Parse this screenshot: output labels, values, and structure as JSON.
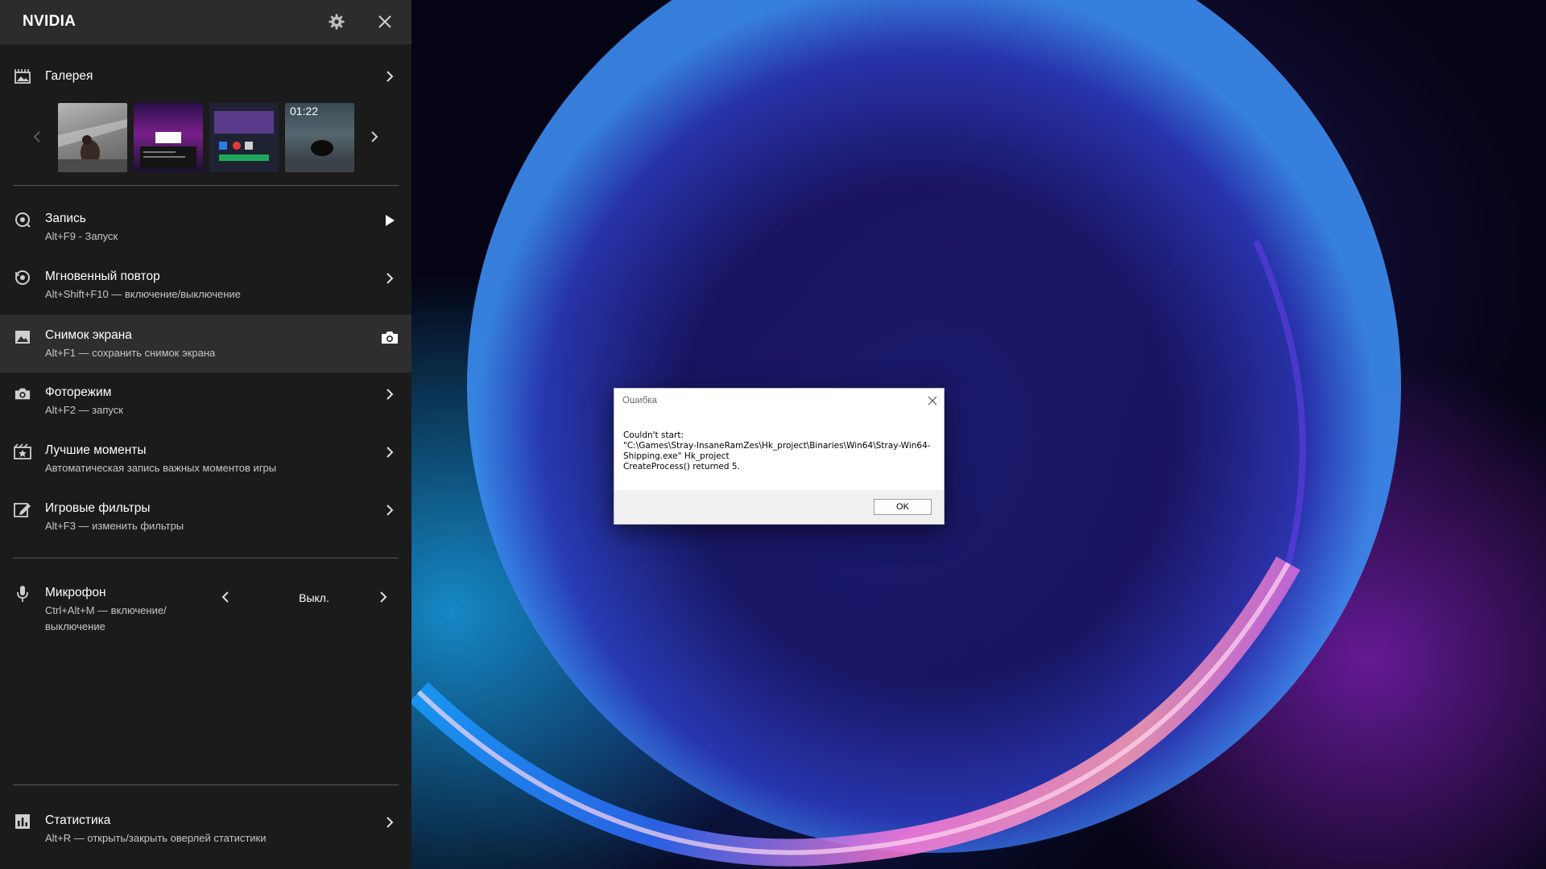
{
  "overlay": {
    "brand": "NVIDIA",
    "gallery": {
      "label": "Галерея",
      "thumbnails": [
        {
          "name": "gallery-thumbnail-1"
        },
        {
          "name": "gallery-thumbnail-2"
        },
        {
          "name": "gallery-thumbnail-3"
        },
        {
          "name": "gallery-thumbnail-4",
          "duration": "01:22"
        }
      ]
    },
    "record": {
      "title": "Запись",
      "subtitle": "Alt+F9 - Запуск"
    },
    "instant_replay": {
      "title": "Мгновенный повтор",
      "subtitle": "Alt+Shift+F10 — включение/выключение"
    },
    "screenshot": {
      "title": "Снимок экрана",
      "subtitle": "Alt+F1 — сохранить снимок экрана"
    },
    "photo_mode": {
      "title": "Фоторежим",
      "subtitle": "Alt+F2 — запуск"
    },
    "highlights": {
      "title": "Лучшие моменты",
      "subtitle": "Автоматическая запись важных моментов игры"
    },
    "game_filters": {
      "title": "Игровые фильтры",
      "subtitle": "Alt+F3 — изменить фильтры"
    },
    "microphone": {
      "title": "Микрофон",
      "subtitle_line1": "Ctrl+Alt+M — включение/",
      "subtitle_line2": "выключение",
      "value": "Выкл."
    },
    "statistics": {
      "title": "Статистика",
      "subtitle": "Alt+R — открыть/закрыть оверлей статистики"
    }
  },
  "dialog": {
    "title": "Ошибка",
    "message": "Couldn't start:\n\"C:\\Games\\Stray-InsaneRamZes\\Hk_project\\Binaries\\Win64\\Stray-Win64-\nShipping.exe\" Hk_project\nCreateProcess() returned 5.",
    "ok_label": "OK"
  },
  "colors": {
    "panel_bg": "#1b1b1b",
    "panel_header_bg": "#2c2c2c",
    "active_row_bg": "#2e2e2e",
    "dialog_footer_bg": "#f0f0f0"
  }
}
